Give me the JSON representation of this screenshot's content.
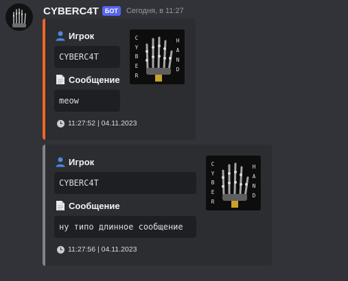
{
  "author": {
    "name": "CYBERC4T",
    "bot_tag": "БОТ",
    "time": "Сегодня, в 11:27",
    "avatar_icon": "cyber-hand-avatar-icon"
  },
  "colors": {
    "embed1_border": "#f26522",
    "embed2_border": "#80848e",
    "bot_tag": "#5865f2"
  },
  "thumbnail": {
    "left_letters": [
      "C",
      "Y",
      "B",
      "E",
      "R"
    ],
    "right_letters": [
      "H",
      "A",
      "N",
      "D"
    ],
    "icon": "cyber-hand-thumbnail"
  },
  "embeds": [
    {
      "player_label": "Игрок",
      "player_value": "CYBERC4T",
      "message_label": "Сообщение",
      "message_value": "meow",
      "footer": "11:27:52 | 04.11.2023"
    },
    {
      "player_label": "Игрок",
      "player_value": "CYBERC4T",
      "message_label": "Сообщение",
      "message_value": "ну типо длинное сообщение",
      "footer": "11:27:56 | 04.11.2023"
    }
  ]
}
